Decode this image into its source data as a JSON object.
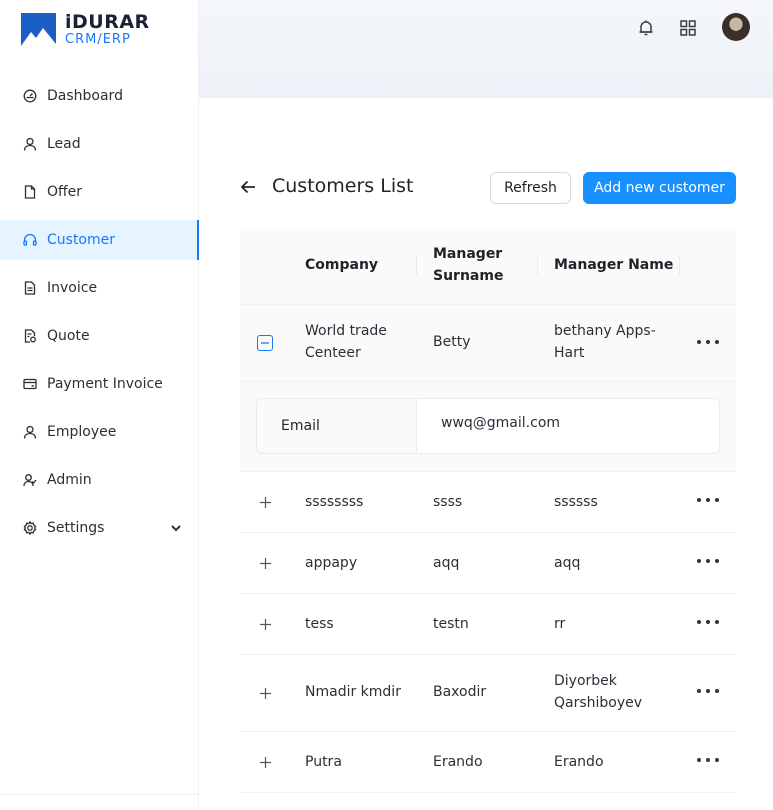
{
  "brand": {
    "title": "iDURAR",
    "subtitle": "CRM/ERP"
  },
  "sidebar": {
    "items": [
      {
        "label": "Dashboard",
        "icon": "dashboard-icon"
      },
      {
        "label": "Lead",
        "icon": "user-icon"
      },
      {
        "label": "Offer",
        "icon": "file-icon"
      },
      {
        "label": "Customer",
        "icon": "headset-icon",
        "active": true
      },
      {
        "label": "Invoice",
        "icon": "file-text-icon"
      },
      {
        "label": "Quote",
        "icon": "file-sync-icon"
      },
      {
        "label": "Payment Invoice",
        "icon": "credit-card-icon"
      },
      {
        "label": "Employee",
        "icon": "user-icon"
      },
      {
        "label": "Admin",
        "icon": "team-icon"
      },
      {
        "label": "Settings",
        "icon": "gear-icon"
      }
    ]
  },
  "header": {
    "icons": [
      "bell-icon",
      "apps-grid-icon",
      "avatar"
    ]
  },
  "page": {
    "title": "Customers List",
    "refresh_label": "Refresh",
    "add_label": "Add new customer"
  },
  "table": {
    "columns": {
      "company": "Company",
      "surname_1": "Manager",
      "surname_2": "Surname",
      "name": "Manager Name"
    },
    "rows": [
      {
        "company_1": "World trade",
        "company_2": "Centeer",
        "surname": "Betty",
        "name_1": "bethany Apps-",
        "name_2": "Hart",
        "expanded": true
      },
      {
        "company": "ssssssss",
        "surname": "ssss",
        "name": "ssssss"
      },
      {
        "company": "appapy",
        "surname": "aqq",
        "name": "aqq"
      },
      {
        "company": "tess",
        "surname": "testn",
        "name": "rr"
      },
      {
        "company": "Nmadir kmdir",
        "surname": "Baxodir",
        "name_1": "Diyorbek",
        "name_2": "Qarshiboyev"
      },
      {
        "company": "Putra",
        "surname": "Erando",
        "name": "Erando"
      }
    ],
    "expanded": {
      "label": "Email",
      "value": "wwq@gmail.com"
    }
  },
  "colors": {
    "accent": "#1677ff",
    "primary_button": "#1890ff",
    "active_bg": "#e6f4ff"
  }
}
